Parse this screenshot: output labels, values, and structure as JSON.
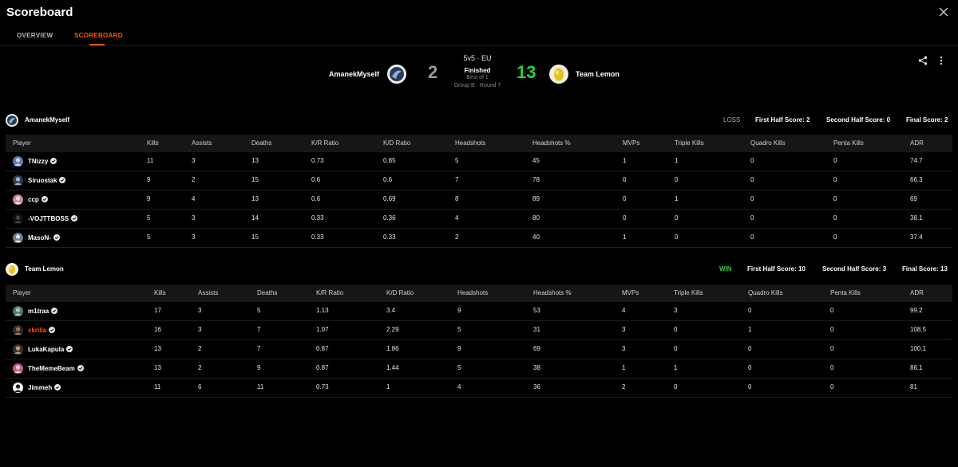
{
  "title": "Scoreboard",
  "tabs": [
    {
      "label": "OVERVIEW",
      "active": false
    },
    {
      "label": "SCOREBOARD",
      "active": true
    }
  ],
  "match": {
    "team1": "AmanekMyself",
    "team2": "Team Lemon",
    "score1": "2",
    "score2": "13",
    "mode": "5v5 · EU",
    "status": "Finished",
    "best_of": "Best of 1",
    "group": "Group B · Round 7"
  },
  "colors": {
    "accent": "#ff5500",
    "win": "#2ecc40",
    "background": "#000000",
    "header_row": "#161616"
  },
  "icons": {
    "close": "close-icon",
    "share": "share-icon",
    "more": "more-vertical-icon",
    "verified": "verified-icon"
  },
  "columns": [
    "Player",
    "Kills",
    "Assists",
    "Deaths",
    "K/R Ratio",
    "K/D Ratio",
    "Headshots",
    "Headshots %",
    "MVPs",
    "Triple Kills",
    "Quadro Kills",
    "Penta Kills",
    "ADR"
  ],
  "teams": [
    {
      "name": "AmanekMyself",
      "result": "LOSS",
      "first_half": "First Half Score: 2",
      "second_half": "Second Half Score: 0",
      "final": "Final Score: 2",
      "players": [
        {
          "name": "TNizzy",
          "stats": [
            "11",
            "3",
            "13",
            "0.73",
            "0.85",
            "5",
            "45",
            "1",
            "1",
            "0",
            "0",
            "74.7"
          ]
        },
        {
          "name": "Siruostak",
          "stats": [
            "9",
            "2",
            "15",
            "0.6",
            "0.6",
            "7",
            "78",
            "0",
            "0",
            "0",
            "0",
            "66.3"
          ]
        },
        {
          "name": "ccp",
          "stats": [
            "9",
            "4",
            "13",
            "0.6",
            "0.69",
            "8",
            "89",
            "0",
            "1",
            "0",
            "0",
            "69"
          ]
        },
        {
          "name": "-VOJTTBOSS",
          "stats": [
            "5",
            "3",
            "14",
            "0.33",
            "0.36",
            "4",
            "80",
            "0",
            "0",
            "0",
            "0",
            "38.1"
          ]
        },
        {
          "name": "MasoN-",
          "stats": [
            "5",
            "3",
            "15",
            "0.33",
            "0.33",
            "2",
            "40",
            "1",
            "0",
            "0",
            "0",
            "37.4"
          ]
        }
      ]
    },
    {
      "name": "Team Lemon",
      "result": "WIN",
      "first_half": "First Half Score: 10",
      "second_half": "Second Half Score: 3",
      "final": "Final Score: 13",
      "players": [
        {
          "name": "m1traa",
          "stats": [
            "17",
            "3",
            "5",
            "1.13",
            "3.4",
            "9",
            "53",
            "4",
            "3",
            "0",
            "0",
            "99.2"
          ]
        },
        {
          "name": "skrilla",
          "highlight": true,
          "stats": [
            "16",
            "3",
            "7",
            "1.07",
            "2.29",
            "5",
            "31",
            "3",
            "0",
            "1",
            "0",
            "108.5"
          ]
        },
        {
          "name": "LukaKapula",
          "stats": [
            "13",
            "2",
            "7",
            "0.87",
            "1.86",
            "9",
            "69",
            "3",
            "0",
            "0",
            "0",
            "100.1"
          ]
        },
        {
          "name": "TheMemeBeam",
          "stats": [
            "13",
            "2",
            "9",
            "0.87",
            "1.44",
            "5",
            "38",
            "1",
            "1",
            "0",
            "0",
            "86.1"
          ]
        },
        {
          "name": "Jimmeh",
          "stats": [
            "11",
            "6",
            "11",
            "0.73",
            "1",
            "4",
            "36",
            "2",
            "0",
            "0",
            "0",
            "81"
          ]
        }
      ]
    }
  ]
}
